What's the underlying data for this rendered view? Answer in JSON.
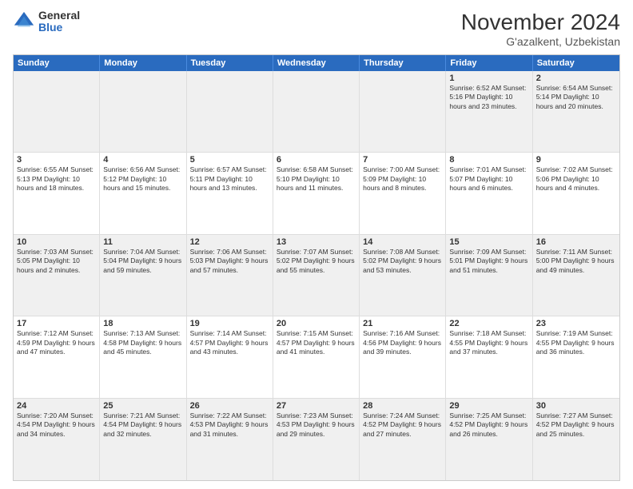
{
  "header": {
    "logo_general": "General",
    "logo_blue": "Blue",
    "month": "November 2024",
    "location": "G'azalkent, Uzbekistan"
  },
  "days_of_week": [
    "Sunday",
    "Monday",
    "Tuesday",
    "Wednesday",
    "Thursday",
    "Friday",
    "Saturday"
  ],
  "rows": [
    [
      {
        "num": "",
        "detail": ""
      },
      {
        "num": "",
        "detail": ""
      },
      {
        "num": "",
        "detail": ""
      },
      {
        "num": "",
        "detail": ""
      },
      {
        "num": "",
        "detail": ""
      },
      {
        "num": "1",
        "detail": "Sunrise: 6:52 AM\nSunset: 5:16 PM\nDaylight: 10 hours\nand 23 minutes."
      },
      {
        "num": "2",
        "detail": "Sunrise: 6:54 AM\nSunset: 5:14 PM\nDaylight: 10 hours\nand 20 minutes."
      }
    ],
    [
      {
        "num": "3",
        "detail": "Sunrise: 6:55 AM\nSunset: 5:13 PM\nDaylight: 10 hours\nand 18 minutes."
      },
      {
        "num": "4",
        "detail": "Sunrise: 6:56 AM\nSunset: 5:12 PM\nDaylight: 10 hours\nand 15 minutes."
      },
      {
        "num": "5",
        "detail": "Sunrise: 6:57 AM\nSunset: 5:11 PM\nDaylight: 10 hours\nand 13 minutes."
      },
      {
        "num": "6",
        "detail": "Sunrise: 6:58 AM\nSunset: 5:10 PM\nDaylight: 10 hours\nand 11 minutes."
      },
      {
        "num": "7",
        "detail": "Sunrise: 7:00 AM\nSunset: 5:09 PM\nDaylight: 10 hours\nand 8 minutes."
      },
      {
        "num": "8",
        "detail": "Sunrise: 7:01 AM\nSunset: 5:07 PM\nDaylight: 10 hours\nand 6 minutes."
      },
      {
        "num": "9",
        "detail": "Sunrise: 7:02 AM\nSunset: 5:06 PM\nDaylight: 10 hours\nand 4 minutes."
      }
    ],
    [
      {
        "num": "10",
        "detail": "Sunrise: 7:03 AM\nSunset: 5:05 PM\nDaylight: 10 hours\nand 2 minutes."
      },
      {
        "num": "11",
        "detail": "Sunrise: 7:04 AM\nSunset: 5:04 PM\nDaylight: 9 hours\nand 59 minutes."
      },
      {
        "num": "12",
        "detail": "Sunrise: 7:06 AM\nSunset: 5:03 PM\nDaylight: 9 hours\nand 57 minutes."
      },
      {
        "num": "13",
        "detail": "Sunrise: 7:07 AM\nSunset: 5:02 PM\nDaylight: 9 hours\nand 55 minutes."
      },
      {
        "num": "14",
        "detail": "Sunrise: 7:08 AM\nSunset: 5:02 PM\nDaylight: 9 hours\nand 53 minutes."
      },
      {
        "num": "15",
        "detail": "Sunrise: 7:09 AM\nSunset: 5:01 PM\nDaylight: 9 hours\nand 51 minutes."
      },
      {
        "num": "16",
        "detail": "Sunrise: 7:11 AM\nSunset: 5:00 PM\nDaylight: 9 hours\nand 49 minutes."
      }
    ],
    [
      {
        "num": "17",
        "detail": "Sunrise: 7:12 AM\nSunset: 4:59 PM\nDaylight: 9 hours\nand 47 minutes."
      },
      {
        "num": "18",
        "detail": "Sunrise: 7:13 AM\nSunset: 4:58 PM\nDaylight: 9 hours\nand 45 minutes."
      },
      {
        "num": "19",
        "detail": "Sunrise: 7:14 AM\nSunset: 4:57 PM\nDaylight: 9 hours\nand 43 minutes."
      },
      {
        "num": "20",
        "detail": "Sunrise: 7:15 AM\nSunset: 4:57 PM\nDaylight: 9 hours\nand 41 minutes."
      },
      {
        "num": "21",
        "detail": "Sunrise: 7:16 AM\nSunset: 4:56 PM\nDaylight: 9 hours\nand 39 minutes."
      },
      {
        "num": "22",
        "detail": "Sunrise: 7:18 AM\nSunset: 4:55 PM\nDaylight: 9 hours\nand 37 minutes."
      },
      {
        "num": "23",
        "detail": "Sunrise: 7:19 AM\nSunset: 4:55 PM\nDaylight: 9 hours\nand 36 minutes."
      }
    ],
    [
      {
        "num": "24",
        "detail": "Sunrise: 7:20 AM\nSunset: 4:54 PM\nDaylight: 9 hours\nand 34 minutes."
      },
      {
        "num": "25",
        "detail": "Sunrise: 7:21 AM\nSunset: 4:54 PM\nDaylight: 9 hours\nand 32 minutes."
      },
      {
        "num": "26",
        "detail": "Sunrise: 7:22 AM\nSunset: 4:53 PM\nDaylight: 9 hours\nand 31 minutes."
      },
      {
        "num": "27",
        "detail": "Sunrise: 7:23 AM\nSunset: 4:53 PM\nDaylight: 9 hours\nand 29 minutes."
      },
      {
        "num": "28",
        "detail": "Sunrise: 7:24 AM\nSunset: 4:52 PM\nDaylight: 9 hours\nand 27 minutes."
      },
      {
        "num": "29",
        "detail": "Sunrise: 7:25 AM\nSunset: 4:52 PM\nDaylight: 9 hours\nand 26 minutes."
      },
      {
        "num": "30",
        "detail": "Sunrise: 7:27 AM\nSunset: 4:52 PM\nDaylight: 9 hours\nand 25 minutes."
      }
    ]
  ]
}
